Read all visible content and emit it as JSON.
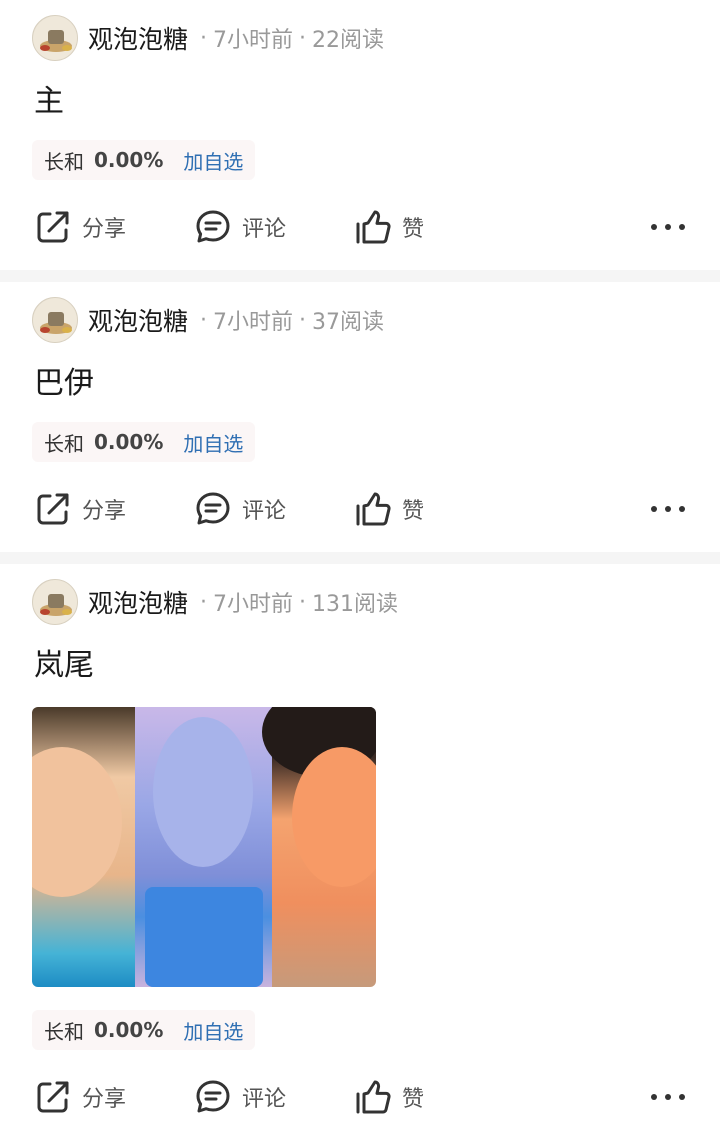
{
  "posts": [
    {
      "author": "观泡泡糖",
      "time": "7小时前",
      "reads": "22阅读",
      "content": "主",
      "stock": {
        "name": "长和",
        "change": "0.00%",
        "add_label": "加自选"
      },
      "actions": {
        "share": "分享",
        "comment": "评论",
        "like": "赞"
      }
    },
    {
      "author": "观泡泡糖",
      "time": "7小时前",
      "reads": "37阅读",
      "content": "巴伊",
      "stock": {
        "name": "长和",
        "change": "0.00%",
        "add_label": "加自选"
      },
      "actions": {
        "share": "分享",
        "comment": "评论",
        "like": "赞"
      }
    },
    {
      "author": "观泡泡糖",
      "time": "7小时前",
      "reads": "131阅读",
      "content": "岚尾",
      "has_image": true,
      "stock": {
        "name": "长和",
        "change": "0.00%",
        "add_label": "加自选"
      },
      "actions": {
        "share": "分享",
        "comment": "评论",
        "like": "赞"
      }
    }
  ],
  "separator": "·",
  "colors": {
    "link": "#2f6fb3",
    "meta": "#999999",
    "stock_bg": "#fbf6f6",
    "divider": "#f5f5f5"
  },
  "icons": [
    "share-icon",
    "comment-icon",
    "like-icon",
    "more-icon"
  ]
}
